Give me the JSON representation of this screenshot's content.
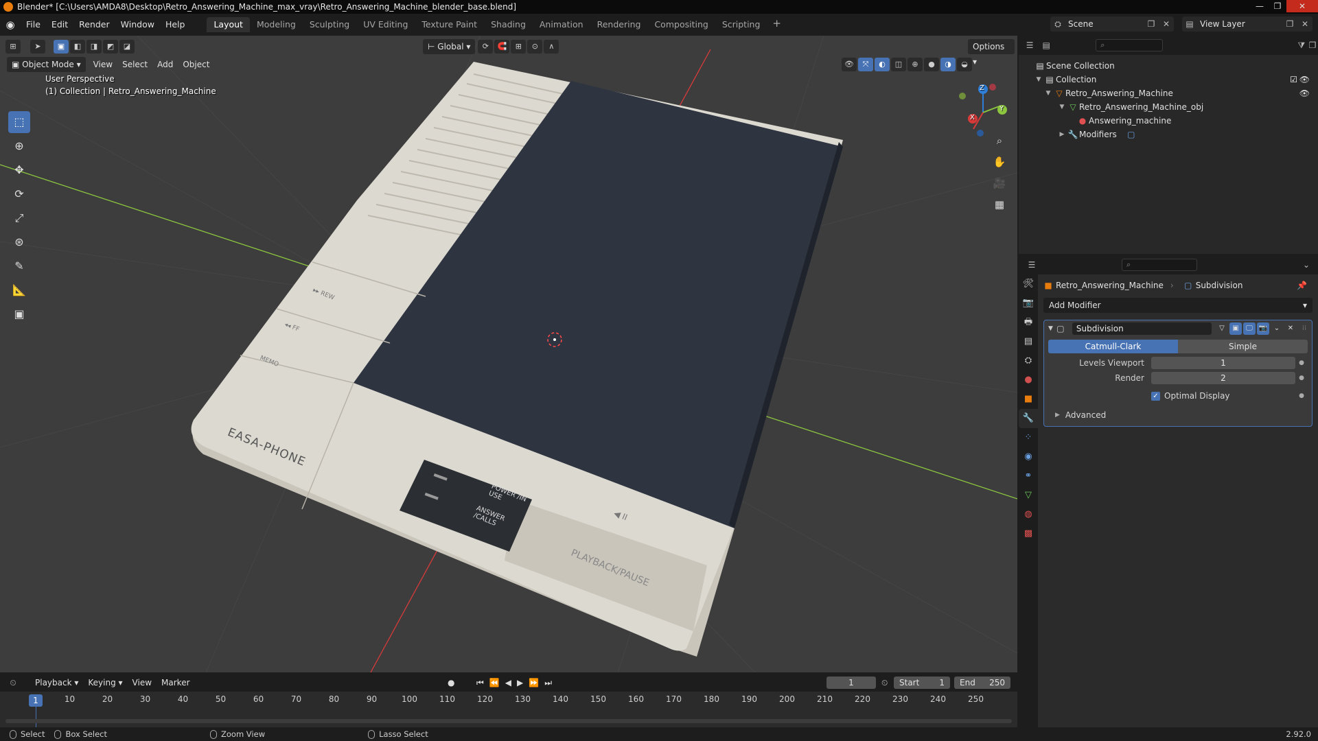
{
  "window": {
    "title": "Blender* [C:\\Users\\AMDA8\\Desktop\\Retro_Answering_Machine_max_vray\\Retro_Answering_Machine_blender_base.blend]",
    "minimize": "—",
    "maximize": "❐",
    "close": "✕"
  },
  "menu": [
    "File",
    "Edit",
    "Render",
    "Window",
    "Help"
  ],
  "workspaces": [
    "Layout",
    "Modeling",
    "Sculpting",
    "UV Editing",
    "Texture Paint",
    "Shading",
    "Animation",
    "Rendering",
    "Compositing",
    "Scripting"
  ],
  "workspace_add": "+",
  "scene": "Scene",
  "view_layer": "View Layer",
  "viewport": {
    "mode": "Object Mode",
    "menus": [
      "View",
      "Select",
      "Add",
      "Object"
    ],
    "transform_orientation": "Global",
    "options": "Options",
    "perspective_label": "User Perspective",
    "collection_label": "(1) Collection | Retro_Answering_Machine",
    "device_labels": {
      "brand": "EASA-PHONE",
      "rew": "▸▸ REW",
      "ff": "◂◂ FF",
      "memo": "MEMO",
      "power": "POWER /IN USE",
      "answer": "ANSWER /CALLS",
      "playback": "PLAYBACK/PAUSE",
      "play_symbol": "◀ II"
    },
    "gizmo_axes": {
      "x": "X",
      "y": "Y",
      "z": "Z"
    }
  },
  "outliner": {
    "search_placeholder": "⌕",
    "items": [
      {
        "label": "Scene Collection",
        "icon": "scene-collection-icon"
      },
      {
        "label": "Collection",
        "icon": "collection-icon"
      },
      {
        "label": "Retro_Answering_Machine",
        "icon": "object-icon"
      },
      {
        "label": "Retro_Answering_Machine_obj",
        "icon": "mesh-icon"
      },
      {
        "label": "Answering_machine",
        "icon": "material-icon"
      },
      {
        "label": "Modifiers",
        "icon": "wrench-icon"
      }
    ]
  },
  "properties": {
    "search_placeholder": "⌕",
    "breadcrumb_object": "Retro_Answering_Machine",
    "breadcrumb_modifier": "Subdivision",
    "add_modifier": "Add Modifier",
    "modifier_name": "Subdivision",
    "modes": [
      "Catmull-Clark",
      "Simple"
    ],
    "levels_viewport_label": "Levels Viewport",
    "levels_viewport": "1",
    "render_label": "Render",
    "render": "2",
    "optimal_display": "Optimal Display",
    "advanced": "Advanced"
  },
  "timeline": {
    "menus": [
      "Playback",
      "Keying",
      "View",
      "Marker"
    ],
    "current_frame": "1",
    "start_label": "Start",
    "start": "1",
    "end_label": "End",
    "end": "250",
    "ticks": [
      "1",
      "10",
      "20",
      "30",
      "40",
      "50",
      "60",
      "70",
      "80",
      "90",
      "100",
      "110",
      "120",
      "130",
      "140",
      "150",
      "160",
      "170",
      "180",
      "190",
      "200",
      "210",
      "220",
      "230",
      "240",
      "250"
    ]
  },
  "status": {
    "select": "Select",
    "box_select": "Box Select",
    "zoom_view": "Zoom View",
    "lasso_select": "Lasso Select",
    "version": "2.92.0"
  },
  "colors": {
    "accent": "#4772b3",
    "viewport_bg": "#3d3d3d",
    "device_body": "#d9d6cd",
    "device_panel": "#2e3440",
    "axis_x": "#d83a3a",
    "axis_y": "#8cc63f"
  }
}
